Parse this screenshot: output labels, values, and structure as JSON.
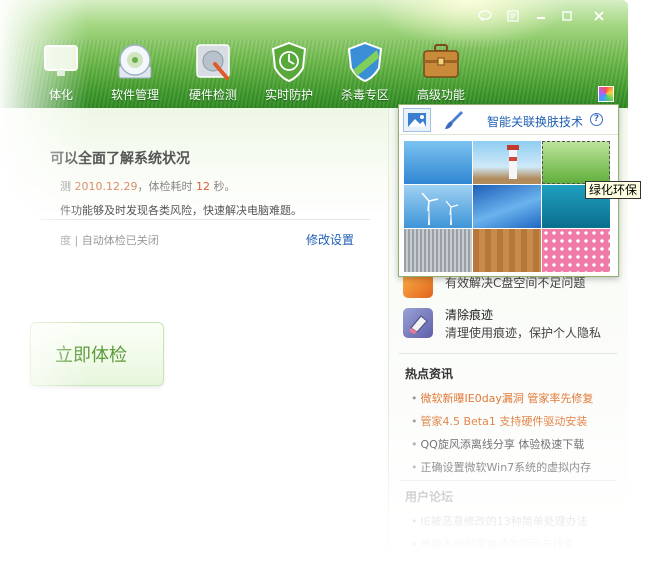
{
  "colors": {
    "accent": "#4fa83a",
    "link": "#1f5fb5",
    "news_orange": "#e07a3a"
  },
  "window_controls": [
    "feedback-icon",
    "menu-icon",
    "minimize-icon",
    "maximize-icon",
    "close-icon"
  ],
  "nav": {
    "items": [
      {
        "label": "体化",
        "icon": "monitor-icon"
      },
      {
        "label": "软件管理",
        "icon": "disc-icon"
      },
      {
        "label": "硬件检测",
        "icon": "hardware-icon"
      },
      {
        "label": "实时防护",
        "icon": "shield-clock-icon"
      },
      {
        "label": "杀毒专区",
        "icon": "shield-icon"
      },
      {
        "label": "高级功能",
        "icon": "toolbox-icon"
      }
    ]
  },
  "main": {
    "title": "可以全面了解系统状况",
    "status_prefix": "测",
    "status_date": "2010.12.29",
    "status_mid": "，体检耗时",
    "status_seconds": "12",
    "status_suffix": "秒。",
    "description": "件功能够及时发现各类风险，快速解决电脑难题。",
    "auto_check": "度 | 自动体检已关闭",
    "modify_link": "修改设置",
    "check_button": "立即体检"
  },
  "side": {
    "item1_sub": "有效解决C盘空间不足问题",
    "item2_title": "清除痕迹",
    "item2_sub": "清理使用痕迹，保护个人隐私",
    "hot_news_title": "热点资讯",
    "news": [
      {
        "text": "微软新曝IE0day漏洞 管家率先修复",
        "hot": true
      },
      {
        "text": "管家4.5 Beta1 支持硬件驱动安装",
        "hot": true
      },
      {
        "text": "QQ旋风添离线分享 体验极速下载",
        "hot": false
      },
      {
        "text": "正确设置微软Win7系统的虚拟内存",
        "hot": false
      }
    ],
    "forum_title": "用户论坛",
    "forum": [
      "IE被恶意修改的13种简单处理办法",
      "电脑系统经常崩溃的原因与排查"
    ]
  },
  "skin_popup": {
    "title": "智能关联换肤技术",
    "help": "?",
    "tooltip": "绿化环保",
    "thumbs": [
      "blue-sky",
      "lighthouse",
      "green-grass",
      "wind-turbines",
      "blue-waves",
      "teal-abstract",
      "gray-metal",
      "wood",
      "pink-dots"
    ]
  }
}
